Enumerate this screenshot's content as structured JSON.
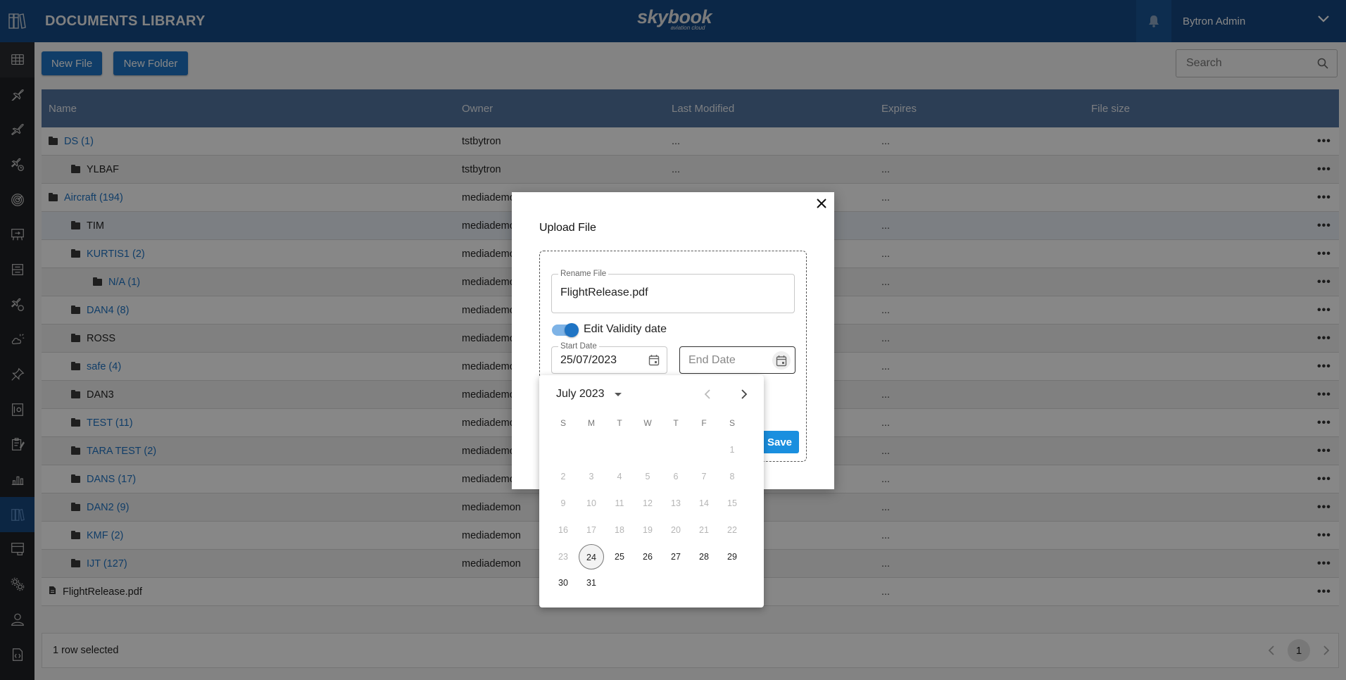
{
  "header": {
    "title": "DOCUMENTS LIBRARY",
    "logo_brand": "skybook",
    "logo_tagline": "aviation cloud",
    "user_name": "Bytron Admin"
  },
  "sidenav": {
    "items": [
      {
        "icon": "grid-icon",
        "label": "Dashboard"
      },
      {
        "icon": "airplane-icon",
        "label": "Flights"
      },
      {
        "icon": "airplane-departure-icon",
        "label": "Departures"
      },
      {
        "icon": "airplane-clock-icon",
        "label": "Schedule"
      },
      {
        "icon": "radar-icon",
        "label": "Radar"
      },
      {
        "icon": "briefing-board-icon",
        "label": "Briefing"
      },
      {
        "icon": "routes-icon",
        "label": "Routes"
      },
      {
        "icon": "airplane-globe-icon",
        "label": "Operations"
      },
      {
        "icon": "weather-icon",
        "label": "Weather"
      },
      {
        "icon": "pin-icon",
        "label": "Pins"
      },
      {
        "icon": "safe-icon",
        "label": "Vault"
      },
      {
        "icon": "clipboard-edit-icon",
        "label": "Reports"
      },
      {
        "icon": "bar-chart-icon",
        "label": "Analytics"
      },
      {
        "icon": "library-icon",
        "label": "Documents Library",
        "active": true
      },
      {
        "icon": "monitor-icon",
        "label": "Display"
      },
      {
        "icon": "gears-icon",
        "label": "Settings"
      },
      {
        "icon": "user-icon",
        "label": "Users"
      },
      {
        "icon": "code-file-icon",
        "label": "API"
      }
    ]
  },
  "toolbar": {
    "new_file_label": "New File",
    "new_folder_label": "New Folder",
    "search_placeholder": "Search"
  },
  "table": {
    "columns": [
      "Name",
      "Owner",
      "Last Modified",
      "Expires",
      "File size"
    ],
    "rows": [
      {
        "name": "DS (1)",
        "link": true,
        "indent": 0,
        "type": "folder",
        "owner": "tstbytron",
        "last_modified": "...",
        "expires": "...",
        "size": ""
      },
      {
        "name": "YLBAF",
        "link": false,
        "indent": 1,
        "type": "folder",
        "owner": "tstbytron",
        "last_modified": "...",
        "expires": "...",
        "size": ""
      },
      {
        "name": "Aircraft (194)",
        "link": true,
        "indent": 0,
        "type": "folder",
        "owner": "mediademon",
        "last_modified": "...",
        "expires": "...",
        "size": ""
      },
      {
        "name": "TIM",
        "link": false,
        "indent": 1,
        "type": "folder",
        "owner": "mediademon",
        "last_modified": "...",
        "expires": "...",
        "size": ""
      },
      {
        "name": "KURTIS1 (2)",
        "link": true,
        "indent": 1,
        "type": "folder",
        "owner": "mediademon",
        "last_modified": "...",
        "expires": "...",
        "size": ""
      },
      {
        "name": "N/A (1)",
        "link": true,
        "indent": 2,
        "type": "folder",
        "owner": "mediademon",
        "last_modified": "...",
        "expires": "...",
        "size": ""
      },
      {
        "name": "DAN4 (8)",
        "link": true,
        "indent": 1,
        "type": "folder",
        "owner": "mediademon",
        "last_modified": "...",
        "expires": "...",
        "size": ""
      },
      {
        "name": "ROSS",
        "link": false,
        "indent": 1,
        "type": "folder",
        "owner": "mediademon",
        "last_modified": "...",
        "expires": "...",
        "size": ""
      },
      {
        "name": "safe (4)",
        "link": true,
        "indent": 1,
        "type": "folder",
        "owner": "mediademon",
        "last_modified": "...",
        "expires": "...",
        "size": ""
      },
      {
        "name": "DAN3",
        "link": false,
        "indent": 1,
        "type": "folder",
        "owner": "mediademon",
        "last_modified": "...",
        "expires": "...",
        "size": ""
      },
      {
        "name": "TEST (11)",
        "link": true,
        "indent": 1,
        "type": "folder",
        "owner": "mediademon",
        "last_modified": "...",
        "expires": "...",
        "size": ""
      },
      {
        "name": "TARA TEST (2)",
        "link": true,
        "indent": 1,
        "type": "folder",
        "owner": "mediademon",
        "last_modified": "...",
        "expires": "...",
        "size": ""
      },
      {
        "name": "DANS (17)",
        "link": true,
        "indent": 1,
        "type": "folder",
        "owner": "mediademon",
        "last_modified": "...",
        "expires": "...",
        "size": ""
      },
      {
        "name": "DAN2 (9)",
        "link": true,
        "indent": 1,
        "type": "folder",
        "owner": "mediademon",
        "last_modified": "...",
        "expires": "...",
        "size": ""
      },
      {
        "name": "KMF (2)",
        "link": true,
        "indent": 1,
        "type": "folder",
        "owner": "mediademon",
        "last_modified": "...",
        "expires": "...",
        "size": ""
      },
      {
        "name": "IJT (127)",
        "link": true,
        "indent": 1,
        "type": "folder",
        "owner": "mediademon",
        "last_modified": "...",
        "expires": "...",
        "size": ""
      },
      {
        "name": "FlightRelease.pdf",
        "link": false,
        "indent": 0,
        "type": "file",
        "owner": "",
        "last_modified": "",
        "expires": "...",
        "size": ""
      }
    ],
    "more_label": "•••",
    "selection_status": "1 row selected",
    "current_page": "1"
  },
  "modal": {
    "title": "Upload File",
    "rename_label": "Rename File",
    "rename_value": "FlightRelease.pdf",
    "toggle_label": "Edit Validity date",
    "toggle_on": true,
    "start_label": "Start Date",
    "start_value": "25/07/2023",
    "end_placeholder": "End Date",
    "save_label": "Save"
  },
  "calendar": {
    "month_label": "July 2023",
    "weekdays": [
      "S",
      "M",
      "T",
      "W",
      "T",
      "F",
      "S"
    ],
    "first_weekday_index": 6,
    "days_in_month": 31,
    "first_enabled_day": 24,
    "today": 24
  }
}
